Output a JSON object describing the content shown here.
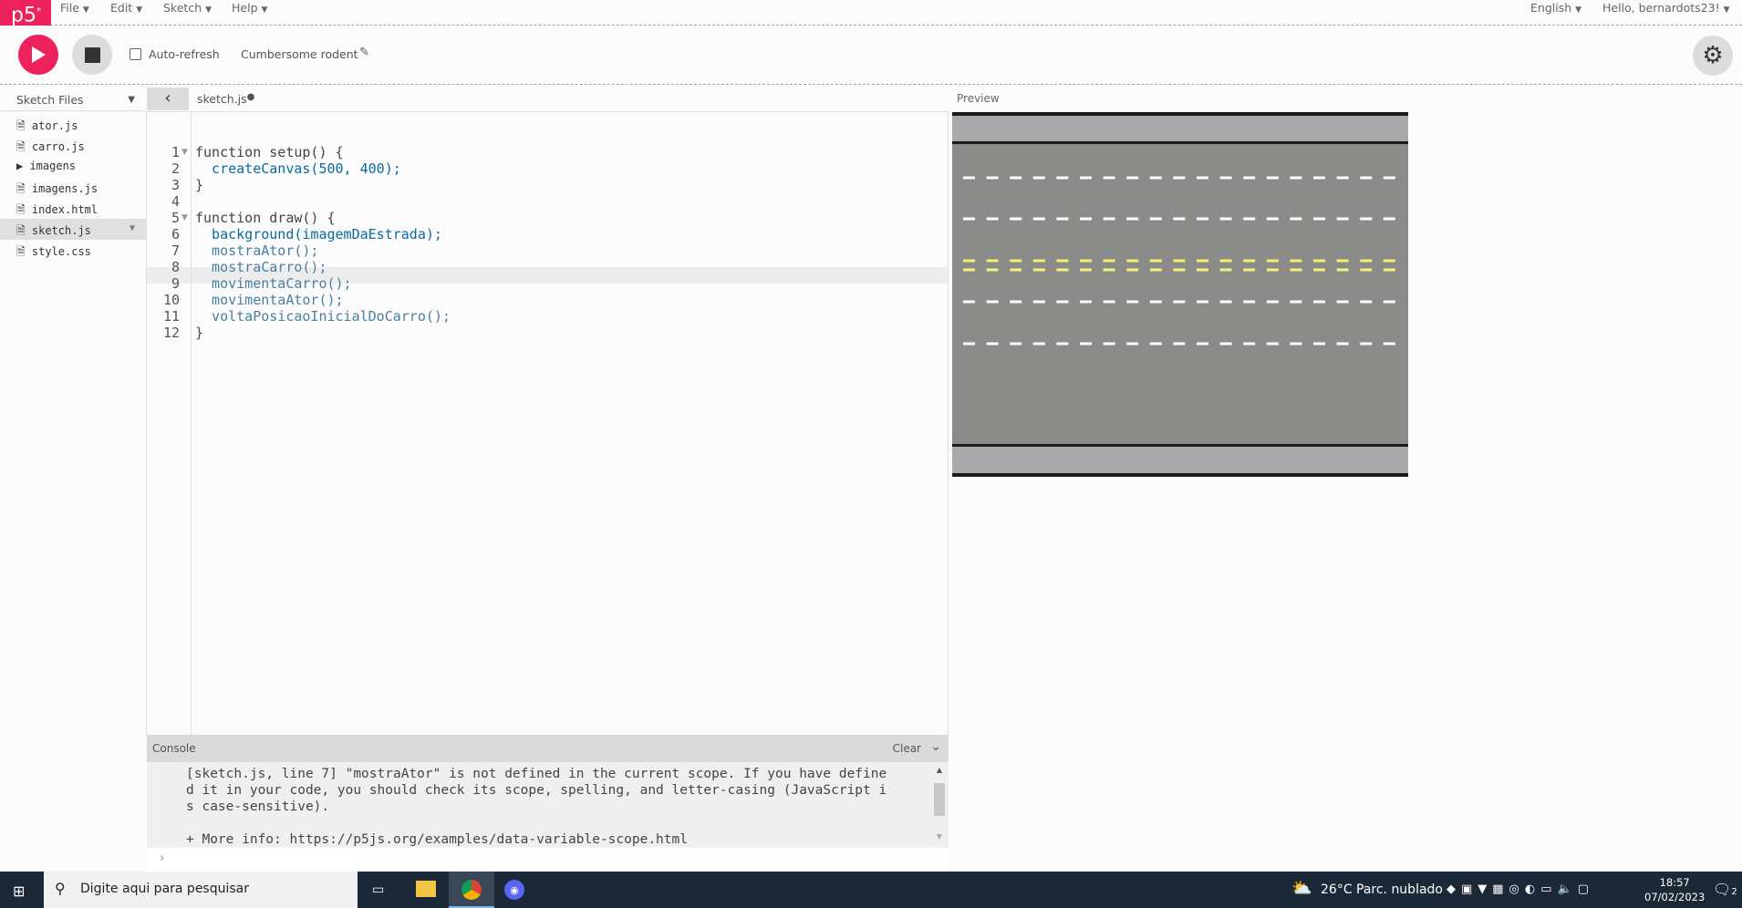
{
  "app": {
    "logo": "p5*",
    "accent": "#ed225d"
  },
  "menu": {
    "items": [
      "File",
      "Edit",
      "Sketch",
      "Help"
    ],
    "language": "English",
    "user": "Hello, bernardots23!"
  },
  "toolbar": {
    "auto_refresh_label": "Auto-refresh",
    "auto_refresh_checked": false,
    "sketch_name": "Cumbersome rodent"
  },
  "sidebar": {
    "title": "Sketch Files",
    "files": [
      {
        "name": "ator.js",
        "type": "file"
      },
      {
        "name": "carro.js",
        "type": "file"
      },
      {
        "name": "imagens",
        "type": "folder"
      },
      {
        "name": "imagens.js",
        "type": "file"
      },
      {
        "name": "index.html",
        "type": "file"
      },
      {
        "name": "sketch.js",
        "type": "file",
        "selected": true
      },
      {
        "name": "style.css",
        "type": "file"
      }
    ]
  },
  "editor": {
    "tab": "sketch.js",
    "unsaved": true,
    "active_line": 9,
    "lines": [
      "function setup() {",
      "  createCanvas(500, 400);",
      "}",
      "",
      "function draw() {",
      "  background(imagemDaEstrada);",
      "  mostraAtor();",
      "  mostraCarro();",
      "  movimentaCarro();",
      "  movimentaAtor();",
      "  voltaPosicaoInicialDoCarro();",
      "}"
    ]
  },
  "console": {
    "title": "Console",
    "clear": "Clear",
    "message": "[sketch.js, line 7] \"mostraAtor\" is not defined in the current scope. If you have define\nd it in your code, you should check its scope, spelling, and letter-casing (JavaScript i\ns case-sensitive).\n\n+ More info: https://p5js.org/examples/data-variable-scope.html",
    "prompt": "›"
  },
  "preview": {
    "label": "Preview"
  },
  "taskbar": {
    "search_placeholder": "Digite aqui para pesquisar",
    "weather": "26°C",
    "weather_desc": "Parc. nublado",
    "time": "18:57",
    "date": "07/02/2023",
    "notifications": "2"
  }
}
